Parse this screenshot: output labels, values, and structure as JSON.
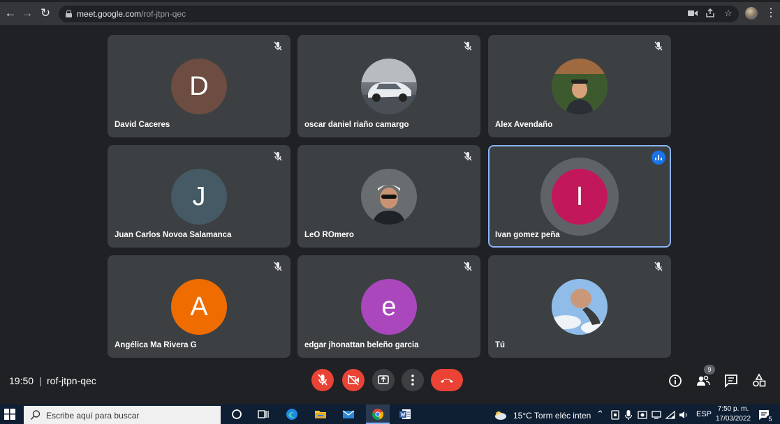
{
  "browser": {
    "url_domain": "meet.google.com",
    "url_path": "/rof-jtpn-qec"
  },
  "participants": [
    {
      "name": "David Caceres",
      "initial": "D",
      "avatar_color": "#6d4c41",
      "photo": false,
      "muted": true
    },
    {
      "name": "oscar daniel riaño camargo",
      "initial": "",
      "photo": true,
      "muted": true
    },
    {
      "name": "Alex Avendaño",
      "initial": "",
      "photo": true,
      "muted": true
    },
    {
      "name": "Juan Carlos Novoa Salamanca",
      "initial": "J",
      "avatar_color": "#455a64",
      "photo": false,
      "muted": true
    },
    {
      "name": "LeO ROmero",
      "initial": "",
      "photo": true,
      "muted": true
    },
    {
      "name": "Ivan gomez peña",
      "initial": "I",
      "avatar_color": "#c2185b",
      "photo": false,
      "muted": false,
      "speaking": true
    },
    {
      "name": "Angélica Ma Rivera G",
      "initial": "A",
      "avatar_color": "#ef6c00",
      "photo": false,
      "muted": true
    },
    {
      "name": "edgar jhonattan beleño garcia",
      "initial": "e",
      "avatar_color": "#ab47bc",
      "photo": false,
      "muted": true
    },
    {
      "name": "Tú",
      "initial": "",
      "photo": true,
      "muted": true
    }
  ],
  "meeting": {
    "time": "19:50",
    "separator": "|",
    "code": "rof-jtpn-qec",
    "people_count": "9"
  },
  "taskbar": {
    "search_placeholder": "Escribe aquí para buscar",
    "weather": "15°C  Torm eléc inten",
    "language": "ESP",
    "time": "7:50 p. m.",
    "date": "17/03/2022",
    "notifications": "5"
  },
  "colors": {
    "background": "#202124",
    "tile": "#3c4043",
    "danger": "#ea4335",
    "speaking_border": "#8ab4f8"
  }
}
